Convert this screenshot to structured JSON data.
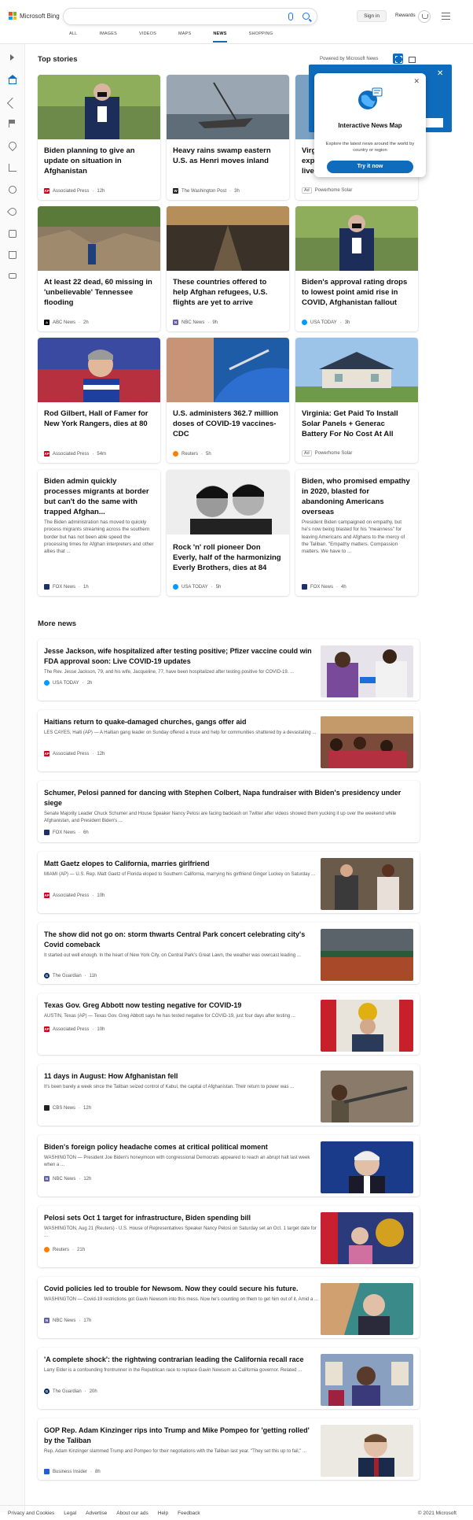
{
  "header": {
    "logo_text": "Microsoft Bing",
    "search_value": "",
    "signin_label": "Sign in",
    "rewards_label": "Rewards"
  },
  "nav": [
    "ALL",
    "IMAGES",
    "VIDEOS",
    "MAPS",
    "NEWS",
    "SHOPPING"
  ],
  "nav_active": "NEWS",
  "top_stories": {
    "title": "Top stories",
    "powered_by": "Powered by Microsoft News",
    "promo": {
      "title": "Interactive News Map",
      "description": "Explore the latest news around the world by country or region",
      "button": "Try it now"
    },
    "partial_card": {
      "title": "Virginia: Get Paid To Install... expen... live i...",
      "title_lines": [
        "Virgi",
        "expe",
        "live i"
      ],
      "ad": "Ad",
      "source": "Powerhome Solar"
    },
    "cards": [
      {
        "title": "Biden planning to give an update on situation in Afghanistan",
        "source": "Associated Press",
        "time": "12h"
      },
      {
        "title": "Heavy rains swamp eastern U.S. as Henri moves inland",
        "source": "The Washington Post",
        "time": "3h"
      },
      {
        "title": "At least 22 dead, 60 missing in 'unbelievable' Tennessee flooding",
        "source": "ABC News",
        "time": "2h"
      },
      {
        "title": "These countries offered to help Afghan refugees, U.S. flights are yet to arrive",
        "source": "NBC News",
        "time": "9h"
      },
      {
        "title": "Biden's approval rating drops to lowest point amid rise in COVID, Afghanistan fallout",
        "source": "USA TODAY",
        "time": "3h"
      },
      {
        "title": "Rod Gilbert, Hall of Famer for New York Rangers, dies at 80",
        "source": "Associated Press",
        "time": "54m"
      },
      {
        "title": "U.S. administers 362.7 million doses of COVID-19 vaccines-CDC",
        "source": "Reuters",
        "time": "5h"
      },
      {
        "title": "Virginia: Get Paid To Install Solar Panels + Generac Battery For No Cost At All",
        "ad": "Ad",
        "source": "Powerhome Solar"
      },
      {
        "title": "Biden admin quickly processes migrants at border but can't do the same with trapped Afghan...",
        "description": "The Biden administration has moved to quickly process migrants streaming across the southern border but has not been able speed the processing times for Afghan interpreters and other allies that ...",
        "source": "FOX News",
        "time": "1h"
      },
      {
        "title": "Rock 'n' roll pioneer Don Everly, half of the harmonizing Everly Brothers, dies at 84",
        "source": "USA TODAY",
        "time": "5h"
      },
      {
        "title": "Biden, who promised empathy in 2020, blasted for abandoning Americans overseas",
        "description": "President Biden campaigned on empathy, but he's now being blasted for his \"meanness\" for leaving Americans and Afghans to the mercy of the Taliban. \"Empathy matters. Compassion matters. We have to ...",
        "source": "FOX News",
        "time": "4h"
      }
    ]
  },
  "more_news": {
    "title": "More news",
    "items": [
      {
        "title": "Jesse Jackson, wife hospitalized after testing positive; Pfizer vaccine could win FDA approval soon: Live COVID-19 updates",
        "desc": "The Rev. Jesse Jackson, 79, and his wife, Jacqueline, 77, have been hospitalized after testing positive for COVID-19. ...",
        "source": "USA TODAY",
        "time": "2h"
      },
      {
        "title": "Haitians return to quake-damaged churches, gangs offer aid",
        "desc": "LES CAYES, Haiti (AP) — A Haitian gang leader on Sunday offered a truce and help for communities shattered by a devastating ...",
        "source": "Associated Press",
        "time": "12h"
      },
      {
        "title": "Schumer, Pelosi panned for dancing with Stephen Colbert, Napa fundraiser with Biden's presidency under siege",
        "desc": "Senate Majority Leader Chuck Schumer and House Speaker Nancy Pelosi are facing backlash on Twitter after videos showed them yucking it up over the weekend while Afghanistan, and President Biden's ...",
        "source": "FOX News",
        "time": "6h"
      },
      {
        "title": "Matt Gaetz elopes to California, marries girlfriend",
        "desc": "MIAMI (AP) — U.S. Rep. Matt Gaetz of Florida eloped to Southern California, marrying his girlfriend Ginger Luckey on Saturday ...",
        "source": "Associated Press",
        "time": "10h"
      },
      {
        "title": "The show did not go on: storm thwarts Central Park concert celebrating city's Covid comeback",
        "desc": "It started out well enough. In the heart of New York City, on Central Park's Great Lawn, the weather was overcast leading ...",
        "source": "The Guardian",
        "time": "11h"
      },
      {
        "title": "Texas Gov. Greg Abbott now testing negative for COVID-19",
        "desc": "AUSTIN, Texas (AP) — Texas Gov. Greg Abbott says he has tested negative for COVID-19, just four days after testing ...",
        "source": "Associated Press",
        "time": "10h"
      },
      {
        "title": "11 days in August: How Afghanistan fell",
        "desc": "It's been barely a week since the Taliban seized control of Kabul, the capital of Afghanistan. Their return to power was ...",
        "source": "CBS News",
        "time": "12h"
      },
      {
        "title": "Biden's foreign policy headache comes at critical political moment",
        "desc": "WASHINGTON — President Joe Biden's honeymoon with congressional Democrats appeared to reach an abrupt halt last week when a ...",
        "source": "NBC News",
        "time": "12h"
      },
      {
        "title": "Pelosi sets Oct 1 target for infrastructure, Biden spending bill",
        "desc": "WASHINGTON, Aug 21 (Reuters) - U.S. House of Representatives Speaker Nancy Pelosi on Saturday set an Oct. 1 target date for ...",
        "source": "Reuters",
        "time": "21h"
      },
      {
        "title": "Covid policies led to trouble for Newsom. Now they could secure his future.",
        "desc": "WASHINGTON — Covid-19 restrictions got Gavin Newsom into this mess. Now he's counting on them to get him out of it. Amid a ...",
        "source": "NBC News",
        "time": "17h"
      },
      {
        "title": "'A complete shock': the rightwing contrarian leading the California recall race",
        "desc": "Larry Elder is a confounding frontrunner in the Republican race to replace Gavin Newsom as California governor. Related ...",
        "source": "The Guardian",
        "time": "20h"
      },
      {
        "title": "GOP Rep. Adam Kinzinger rips into Trump and Mike Pompeo for 'getting rolled' by the Taliban",
        "desc": "Rep. Adam Kinzinger slammed Trump and Pompeo for their negotiations with the Taliban last year. \"They set this up to fail,\" ...",
        "source": "Business Insider",
        "time": "8h"
      }
    ]
  },
  "footer": {
    "links": [
      "Privacy and Cookies",
      "Legal",
      "Advertise",
      "About our ads",
      "Help",
      "Feedback"
    ],
    "copyright": "© 2021 Microsoft"
  },
  "colors": {
    "accent": "#0f6cbd",
    "ap_red": "#d6001c",
    "usa_today": "#009bff",
    "fox": "#1b2f6b",
    "reuters": "#ff8000"
  },
  "icons": [
    "expand-icon",
    "home-icon",
    "shuffle-icon",
    "flag-icon",
    "location-icon",
    "trending-icon",
    "science-icon",
    "rocket-icon",
    "tv-icon",
    "money-icon",
    "card-icon"
  ]
}
